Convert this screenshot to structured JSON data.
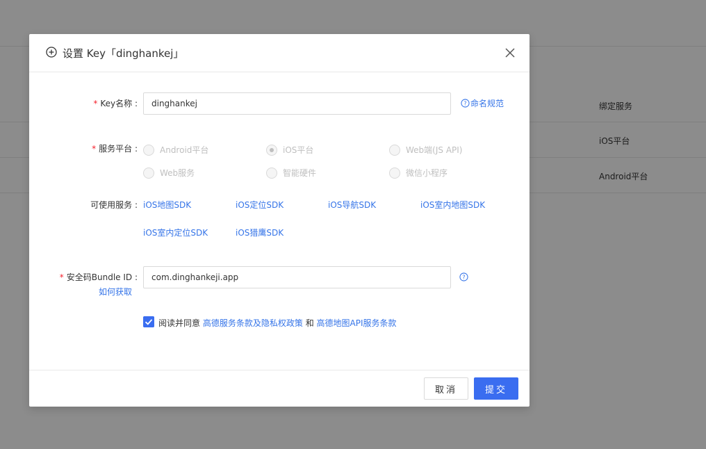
{
  "background": {
    "rows": [
      {
        "cell": "绑定服务"
      },
      {
        "cell": "iOS平台"
      },
      {
        "cell": "Android平台"
      }
    ]
  },
  "dialog": {
    "title": "设置 Key「dinghankej」",
    "title_icon": "plus-circle-icon",
    "close_icon": "close-icon",
    "key_name": {
      "required_mark": "*",
      "label": "Key名称 :",
      "value": "dinghankej",
      "help_link": "命名规范"
    },
    "platform": {
      "required_mark": "*",
      "label": "服务平台 :",
      "options": [
        {
          "label": "Android平台",
          "checked": false
        },
        {
          "label": "iOS平台",
          "checked": true
        },
        {
          "label": "Web端(JS API)",
          "checked": false
        },
        {
          "label": "Web服务",
          "checked": false
        },
        {
          "label": "智能硬件",
          "checked": false
        },
        {
          "label": "微信小程序",
          "checked": false
        }
      ]
    },
    "services": {
      "label": "可使用服务 :",
      "items": [
        "iOS地图SDK",
        "iOS定位SDK",
        "iOS导航SDK",
        "iOS室内地图SDK",
        "iOS室内定位SDK",
        "iOS猎鹰SDK"
      ]
    },
    "bundle": {
      "required_mark": "*",
      "label": "安全码Bundle ID :",
      "how_link": "如何获取",
      "value": "com.dinghankeji.app"
    },
    "agreement": {
      "checked": true,
      "prefix": "阅读并同意",
      "link1": "高德服务条款及隐私权政策",
      "and": "和",
      "link2": "高德地图API服务条款"
    },
    "footer": {
      "cancel_label": "取消",
      "submit_label": "提交"
    }
  },
  "colors": {
    "accent": "#3a6df0",
    "link": "#3574e8",
    "required": "#f5222d"
  }
}
